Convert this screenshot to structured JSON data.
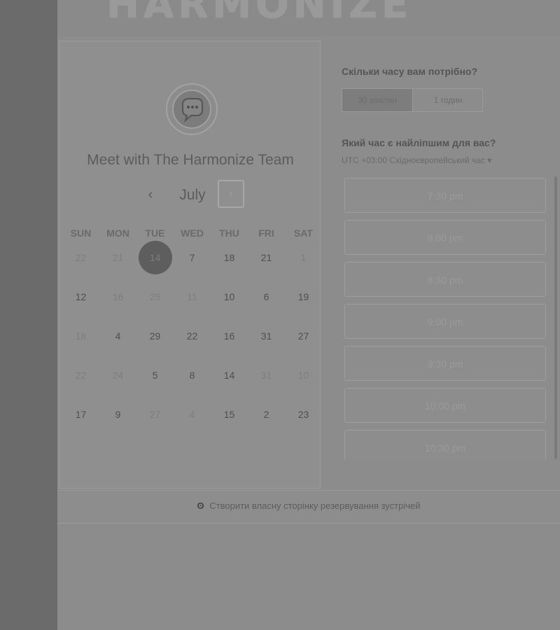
{
  "header": {
    "logo_text": "HARMONIZE"
  },
  "profile": {
    "title": "Meet with The Harmonize Team",
    "avatar_icon": "chat-bubble-icon"
  },
  "calendar": {
    "month": "July",
    "prev_glyph": "‹",
    "next_glyph": "›",
    "weekdays": [
      "SUN",
      "MON",
      "TUE",
      "WED",
      "THU",
      "FRI",
      "SAT"
    ],
    "weeks": [
      [
        {
          "d": "22",
          "s": "muted"
        },
        {
          "d": "21",
          "s": "muted"
        },
        {
          "d": "14",
          "s": "selected"
        },
        {
          "d": "7",
          "s": ""
        },
        {
          "d": "18",
          "s": ""
        },
        {
          "d": "21",
          "s": ""
        },
        {
          "d": "1",
          "s": "muted"
        }
      ],
      [
        {
          "d": "12",
          "s": ""
        },
        {
          "d": "16",
          "s": "muted"
        },
        {
          "d": "25",
          "s": "muted"
        },
        {
          "d": "11",
          "s": "muted"
        },
        {
          "d": "10",
          "s": ""
        },
        {
          "d": "6",
          "s": ""
        },
        {
          "d": "19",
          "s": ""
        }
      ],
      [
        {
          "d": "18",
          "s": "muted"
        },
        {
          "d": "4",
          "s": ""
        },
        {
          "d": "29",
          "s": ""
        },
        {
          "d": "22",
          "s": ""
        },
        {
          "d": "16",
          "s": ""
        },
        {
          "d": "31",
          "s": ""
        },
        {
          "d": "27",
          "s": ""
        }
      ],
      [
        {
          "d": "22",
          "s": "muted"
        },
        {
          "d": "24",
          "s": "muted"
        },
        {
          "d": "5",
          "s": ""
        },
        {
          "d": "8",
          "s": ""
        },
        {
          "d": "14",
          "s": ""
        },
        {
          "d": "31",
          "s": "muted"
        },
        {
          "d": "10",
          "s": "muted"
        }
      ],
      [
        {
          "d": "17",
          "s": ""
        },
        {
          "d": "9",
          "s": ""
        },
        {
          "d": "27",
          "s": "muted"
        },
        {
          "d": "4",
          "s": "muted"
        },
        {
          "d": "15",
          "s": ""
        },
        {
          "d": "2",
          "s": ""
        },
        {
          "d": "23",
          "s": ""
        }
      ]
    ],
    "selected_color": "#5e5e5e"
  },
  "duration": {
    "heading": "Скільки часу вам потрібно?",
    "options": [
      "30 хвилин",
      "1 годин"
    ],
    "selected_index": 0
  },
  "time": {
    "heading": "Який час є найліпшим для вас?",
    "timezone": "UTC +03:00 Східноєвропейський час ▾",
    "slots": [
      "7:30 pm",
      "8:00 pm",
      "8:30 pm",
      "9:00 pm",
      "9:30 pm",
      "10:00 pm",
      "10:30 pm"
    ]
  },
  "footer": {
    "icon": "ʘ",
    "link": "Створити власну сторінку резервування зустрічей"
  }
}
